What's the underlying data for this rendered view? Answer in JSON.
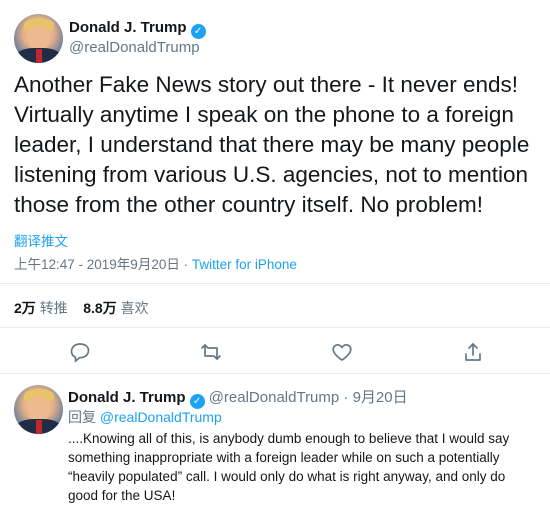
{
  "main_tweet": {
    "author_name": "Donald J. Trump",
    "author_handle": "@realDonaldTrump",
    "verified_mark": "✓",
    "text": "Another Fake News story out there - It never ends! Virtually anytime I speak on the phone to a foreign leader, I understand that there may be many people listening from various U.S. agencies, not to mention those from the other country itself. No problem!",
    "translate_label": "翻译推文",
    "timestamp": "上午12:47 - 2019年9月20日",
    "separator": "·",
    "source": "Twitter for iPhone",
    "retweets_count": "2万",
    "retweets_label": "转推",
    "likes_count": "8.8万",
    "likes_label": "喜欢"
  },
  "actions": [
    "reply-icon",
    "retweet-icon",
    "like-icon",
    "share-icon"
  ],
  "reply_tweet": {
    "author_name": "Donald J. Trump",
    "author_handle": "@realDonaldTrump",
    "date": "9月20日",
    "separator": "·",
    "reply_prefix": "回复",
    "reply_to_handle": "@realDonaldTrump",
    "text": "....Knowing all of this, is anybody dumb enough to believe that I would say something inappropriate with a foreign leader while on such a potentially “heavily populated” call. I would only do what is right anyway, and only do good for the USA!"
  },
  "colors": {
    "accent": "#1da1f2",
    "muted": "#657786",
    "text": "#14171a",
    "divider": "#e6ecf0"
  }
}
